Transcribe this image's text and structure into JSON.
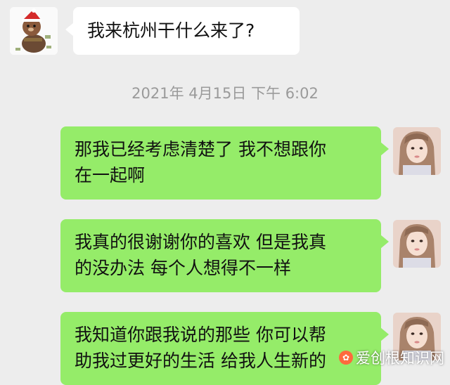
{
  "chat": {
    "timestamp": "2021年 4月15日 下午 6:02",
    "messages": [
      {
        "side": "left",
        "lines": [
          "我来杭州干什么来了?"
        ]
      },
      {
        "side": "right",
        "lines": [
          "那我已经考虑清楚了 我不想跟你",
          "在一起啊"
        ]
      },
      {
        "side": "right",
        "lines": [
          "我真的很谢谢你的喜欢 但是我真",
          "的没办法 每个人想得不一样"
        ]
      },
      {
        "side": "right",
        "lines": [
          "我知道你跟我说的那些 你可以帮",
          "助我过更好的生活 给我人生新的"
        ]
      }
    ]
  },
  "watermark": {
    "text": "爱创根知识网",
    "logo_icon": "watermark-logo-icon"
  },
  "colors": {
    "background": "#ededed",
    "sent_bubble": "#95ec69",
    "received_bubble": "#ffffff",
    "timestamp_text": "#9a9a9a"
  }
}
